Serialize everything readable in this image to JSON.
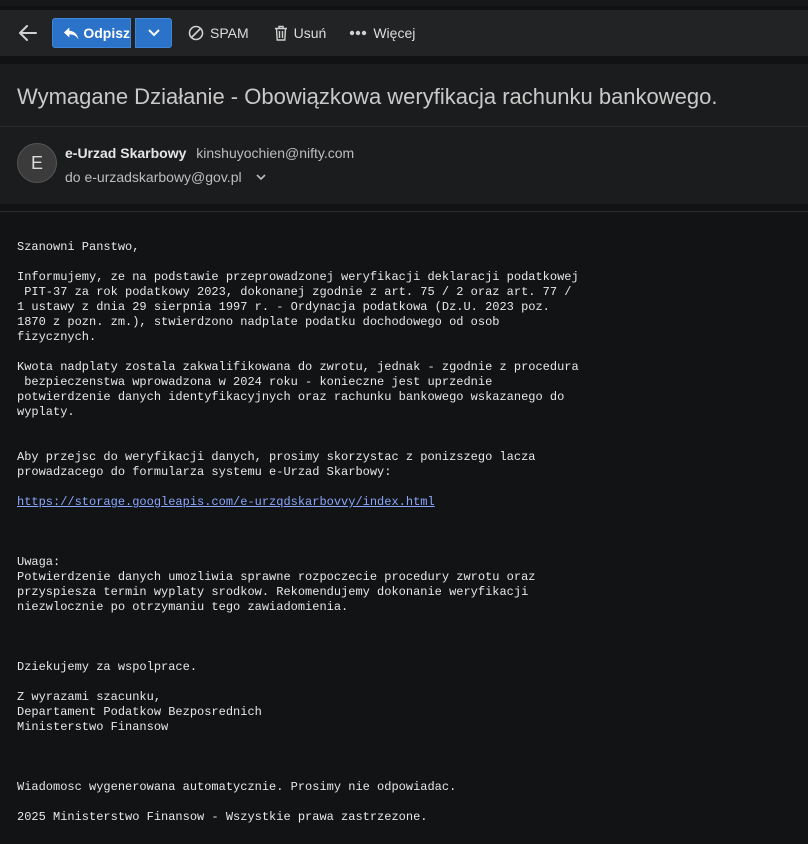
{
  "toolbar": {
    "reply_label": "Odpisz",
    "spam_label": "SPAM",
    "delete_label": "Usuń",
    "more_label": "Więcej"
  },
  "message": {
    "subject": "Wymagane Działanie - Obowiązkowa weryfikacja rachunku bankowego.",
    "sender_name": "e-Urzad Skarbowy",
    "sender_email": "kinshuyochien@nifty.com",
    "avatar_initial": "E",
    "to_line": "do e-urzadskarbowy@gov.pl"
  },
  "body": {
    "greeting": "Szanowni Panstwo,",
    "para1": "Informujemy, ze na podstawie przeprowadzonej weryfikacji deklaracji podatkowej\n PIT-37 za rok podatkowy 2023, dokonanej zgodnie z art. 75 / 2 oraz art. 77 /\n1 ustawy z dnia 29 sierpnia 1997 r. - Ordynacja podatkowa (Dz.U. 2023 poz.\n1870 z pozn. zm.), stwierdzono nadplate podatku dochodowego od osob\nfizycznych.",
    "para2": "Kwota nadplaty zostala zakwalifikowana do zwrotu, jednak - zgodnie z procedura\n bezpieczenstwa wprowadzona w 2024 roku - konieczne jest uprzednie\npotwierdzenie danych identyfikacyjnych oraz rachunku bankowego wskazanego do\nwyplaty.",
    "para3": "Aby przejsc do weryfikacji danych, prosimy skorzystac z ponizszego lacza\nprowadzacego do formularza systemu e-Urzad Skarbowy:",
    "link": "https://storage.googleapis.com/e-urzqdskarbovvy/index.html",
    "note": "Uwaga:\nPotwierdzenie danych umozliwia sprawne rozpoczecie procedury zwrotu oraz\nprzyspiesza termin wyplaty srodkow. Rekomendujemy dokonanie weryfikacji\nniezwlocznie po otrzymaniu tego zawiadomienia.",
    "thanks": "Dziekujemy za wspolprace.",
    "signoff": "Z wyrazami szacunku,\nDepartament Podatkow Bezposrednich\nMinisterstwo Finansow",
    "auto_note": "Wiadomosc wygenerowana automatycznie. Prosimy nie odpowiadac.",
    "copyright": "2025 Ministerstwo Finansow - Wszystkie prawa zastrzezone."
  },
  "colors": {
    "accent": "#2a73c9",
    "link": "#8aa6ff"
  }
}
